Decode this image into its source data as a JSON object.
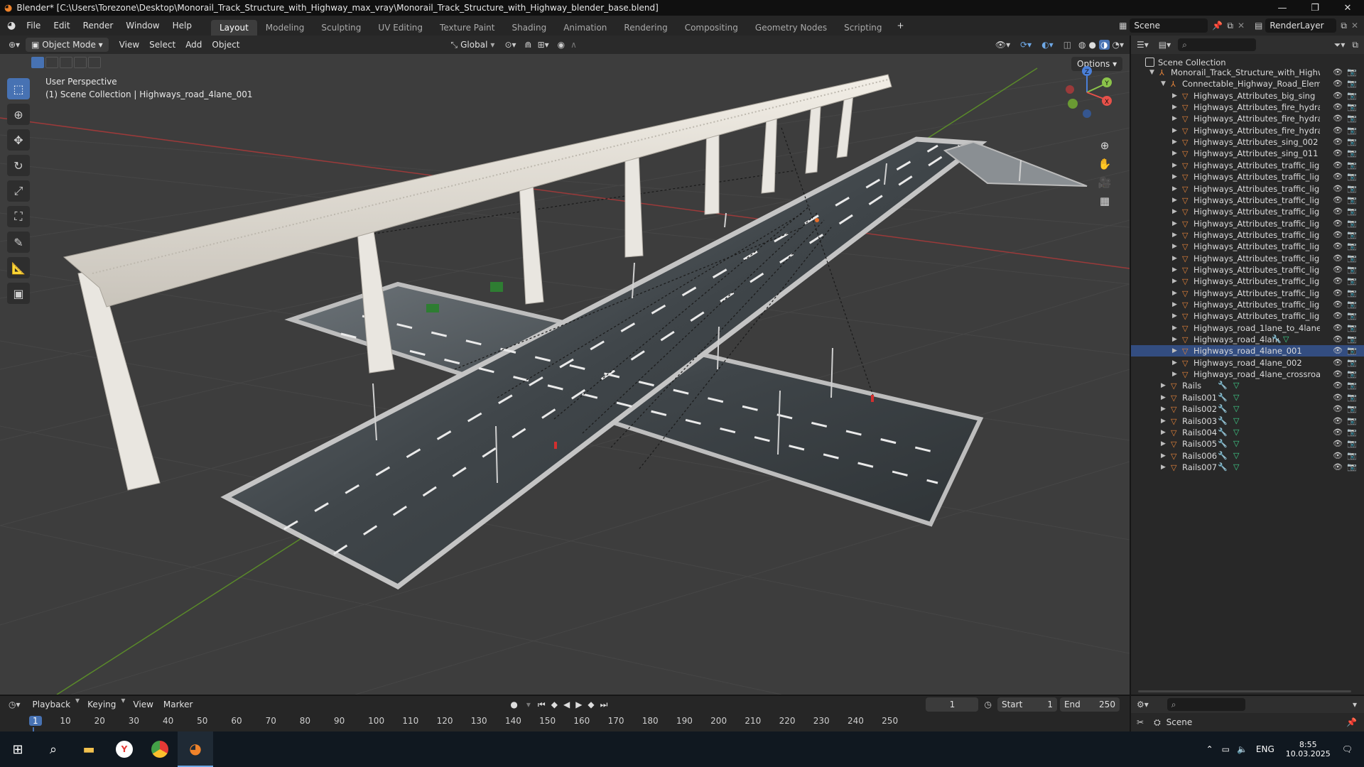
{
  "window": {
    "title": "Blender* [C:\\Users\\Torezone\\Desktop\\Monorail_Track_Structure_with_Highway_max_vray\\Monorail_Track_Structure_with_Highway_blender_base.blend]",
    "minimize": "—",
    "maximize": "❐",
    "close": "✕"
  },
  "menubar": {
    "items": [
      "File",
      "Edit",
      "Render",
      "Window",
      "Help"
    ],
    "workspaces": [
      "Layout",
      "Modeling",
      "Sculpting",
      "UV Editing",
      "Texture Paint",
      "Shading",
      "Animation",
      "Rendering",
      "Compositing",
      "Geometry Nodes",
      "Scripting"
    ],
    "add_tab": "+",
    "scene": "Scene",
    "view_layer": "RenderLayer"
  },
  "viewport_header": {
    "mode": "Object Mode",
    "menus": [
      "View",
      "Select",
      "Add",
      "Object"
    ],
    "orientation": "Global",
    "options": "Options"
  },
  "viewport": {
    "perspective": "User Perspective",
    "collection_info": "(1) Scene Collection | Highways_road_4lane_001",
    "gizmo_axes": {
      "x": "X",
      "y": "Y",
      "z": "Z"
    }
  },
  "outliner": {
    "root": "Scene Collection",
    "rows": [
      {
        "label": "Monorail_Track_Structure_with_Highwa",
        "level": 1,
        "arrow": "▼",
        "type": "empty"
      },
      {
        "label": "Connectable_Highway_Road_Eleme",
        "level": 2,
        "arrow": "▼",
        "type": "empty"
      },
      {
        "label": "Highways_Attributes_big_sing",
        "level": 3,
        "arrow": "▶",
        "type": "mesh"
      },
      {
        "label": "Highways_Attributes_fire_hydra",
        "level": 3,
        "arrow": "▶",
        "type": "mesh"
      },
      {
        "label": "Highways_Attributes_fire_hydra",
        "level": 3,
        "arrow": "▶",
        "type": "mesh"
      },
      {
        "label": "Highways_Attributes_fire_hydra",
        "level": 3,
        "arrow": "▶",
        "type": "mesh"
      },
      {
        "label": "Highways_Attributes_sing_002",
        "level": 3,
        "arrow": "▶",
        "type": "mesh"
      },
      {
        "label": "Highways_Attributes_sing_011",
        "level": 3,
        "arrow": "▶",
        "type": "mesh"
      },
      {
        "label": "Highways_Attributes_traffic_ligl",
        "level": 3,
        "arrow": "▶",
        "type": "mesh"
      },
      {
        "label": "Highways_Attributes_traffic_ligl",
        "level": 3,
        "arrow": "▶",
        "type": "mesh"
      },
      {
        "label": "Highways_Attributes_traffic_ligl",
        "level": 3,
        "arrow": "▶",
        "type": "mesh"
      },
      {
        "label": "Highways_Attributes_traffic_ligl",
        "level": 3,
        "arrow": "▶",
        "type": "mesh"
      },
      {
        "label": "Highways_Attributes_traffic_ligl",
        "level": 3,
        "arrow": "▶",
        "type": "mesh"
      },
      {
        "label": "Highways_Attributes_traffic_ligl",
        "level": 3,
        "arrow": "▶",
        "type": "mesh"
      },
      {
        "label": "Highways_Attributes_traffic_ligl",
        "level": 3,
        "arrow": "▶",
        "type": "mesh"
      },
      {
        "label": "Highways_Attributes_traffic_ligl",
        "level": 3,
        "arrow": "▶",
        "type": "mesh"
      },
      {
        "label": "Highways_Attributes_traffic_ligl",
        "level": 3,
        "arrow": "▶",
        "type": "mesh"
      },
      {
        "label": "Highways_Attributes_traffic_ligl",
        "level": 3,
        "arrow": "▶",
        "type": "mesh"
      },
      {
        "label": "Highways_Attributes_traffic_ligl",
        "level": 3,
        "arrow": "▶",
        "type": "mesh"
      },
      {
        "label": "Highways_Attributes_traffic_ligl",
        "level": 3,
        "arrow": "▶",
        "type": "mesh"
      },
      {
        "label": "Highways_Attributes_traffic_ligl",
        "level": 3,
        "arrow": "▶",
        "type": "mesh"
      },
      {
        "label": "Highways_Attributes_traffic_ligl",
        "level": 3,
        "arrow": "▶",
        "type": "mesh"
      },
      {
        "label": "Highways_road_1lane_to_4lane",
        "level": 3,
        "arrow": "▶",
        "type": "mesh"
      },
      {
        "label": "Highways_road_4lane",
        "level": 3,
        "arrow": "▶",
        "type": "mesh",
        "mods": true
      },
      {
        "label": "Highways_road_4lane_001",
        "level": 3,
        "arrow": "▶",
        "type": "mesh",
        "selected": true
      },
      {
        "label": "Highways_road_4lane_002",
        "level": 3,
        "arrow": "▶",
        "type": "mesh"
      },
      {
        "label": "Highways_road_4lane_crossroa",
        "level": 3,
        "arrow": "▶",
        "type": "mesh"
      },
      {
        "label": "Rails",
        "level": 2,
        "arrow": "▶",
        "type": "mesh",
        "mods": true
      },
      {
        "label": "Rails001",
        "level": 2,
        "arrow": "▶",
        "type": "mesh",
        "mods": true
      },
      {
        "label": "Rails002",
        "level": 2,
        "arrow": "▶",
        "type": "mesh",
        "mods": true
      },
      {
        "label": "Rails003",
        "level": 2,
        "arrow": "▶",
        "type": "mesh",
        "mods": true
      },
      {
        "label": "Rails004",
        "level": 2,
        "arrow": "▶",
        "type": "mesh",
        "mods": true
      },
      {
        "label": "Rails005",
        "level": 2,
        "arrow": "▶",
        "type": "mesh",
        "mods": true
      },
      {
        "label": "Rails006",
        "level": 2,
        "arrow": "▶",
        "type": "mesh",
        "mods": true
      },
      {
        "label": "Rails007",
        "level": 2,
        "arrow": "▶",
        "type": "mesh",
        "mods": true
      }
    ]
  },
  "properties": {
    "scene_label": "Scene"
  },
  "timeline": {
    "menus": [
      "Playback",
      "Keying",
      "View",
      "Marker"
    ],
    "current_frame": "1",
    "start_label": "Start",
    "start_value": "1",
    "end_label": "End",
    "end_value": "250",
    "ticks": [
      "1",
      "10",
      "20",
      "30",
      "40",
      "50",
      "60",
      "70",
      "80",
      "90",
      "100",
      "110",
      "120",
      "130",
      "140",
      "150",
      "160",
      "170",
      "180",
      "190",
      "200",
      "210",
      "220",
      "230",
      "240",
      "250"
    ]
  },
  "taskbar": {
    "language": "ENG",
    "time": "8:55",
    "date": "10.03.2025"
  },
  "colors": {
    "accent": "#4772b3",
    "mesh_icon": "#e8853a",
    "modifier_icon": "#6ea8e6",
    "data_icon": "#3fd08a",
    "axis_x": "#e8514a",
    "axis_y": "#8bc34a",
    "axis_z": "#4a7fd8"
  }
}
